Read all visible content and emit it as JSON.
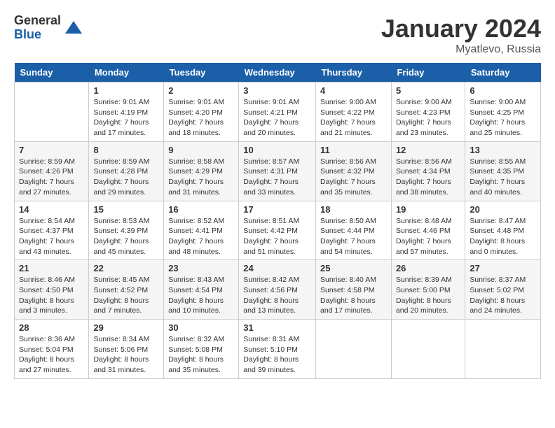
{
  "header": {
    "logo_general": "General",
    "logo_blue": "Blue",
    "month_title": "January 2024",
    "location": "Myatlevo, Russia"
  },
  "days_of_week": [
    "Sunday",
    "Monday",
    "Tuesday",
    "Wednesday",
    "Thursday",
    "Friday",
    "Saturday"
  ],
  "weeks": [
    [
      {
        "day": "",
        "info": ""
      },
      {
        "day": "1",
        "info": "Sunrise: 9:01 AM\nSunset: 4:19 PM\nDaylight: 7 hours\nand 17 minutes."
      },
      {
        "day": "2",
        "info": "Sunrise: 9:01 AM\nSunset: 4:20 PM\nDaylight: 7 hours\nand 18 minutes."
      },
      {
        "day": "3",
        "info": "Sunrise: 9:01 AM\nSunset: 4:21 PM\nDaylight: 7 hours\nand 20 minutes."
      },
      {
        "day": "4",
        "info": "Sunrise: 9:00 AM\nSunset: 4:22 PM\nDaylight: 7 hours\nand 21 minutes."
      },
      {
        "day": "5",
        "info": "Sunrise: 9:00 AM\nSunset: 4:23 PM\nDaylight: 7 hours\nand 23 minutes."
      },
      {
        "day": "6",
        "info": "Sunrise: 9:00 AM\nSunset: 4:25 PM\nDaylight: 7 hours\nand 25 minutes."
      }
    ],
    [
      {
        "day": "7",
        "info": "Sunrise: 8:59 AM\nSunset: 4:26 PM\nDaylight: 7 hours\nand 27 minutes."
      },
      {
        "day": "8",
        "info": "Sunrise: 8:59 AM\nSunset: 4:28 PM\nDaylight: 7 hours\nand 29 minutes."
      },
      {
        "day": "9",
        "info": "Sunrise: 8:58 AM\nSunset: 4:29 PM\nDaylight: 7 hours\nand 31 minutes."
      },
      {
        "day": "10",
        "info": "Sunrise: 8:57 AM\nSunset: 4:31 PM\nDaylight: 7 hours\nand 33 minutes."
      },
      {
        "day": "11",
        "info": "Sunrise: 8:56 AM\nSunset: 4:32 PM\nDaylight: 7 hours\nand 35 minutes."
      },
      {
        "day": "12",
        "info": "Sunrise: 8:56 AM\nSunset: 4:34 PM\nDaylight: 7 hours\nand 38 minutes."
      },
      {
        "day": "13",
        "info": "Sunrise: 8:55 AM\nSunset: 4:35 PM\nDaylight: 7 hours\nand 40 minutes."
      }
    ],
    [
      {
        "day": "14",
        "info": "Sunrise: 8:54 AM\nSunset: 4:37 PM\nDaylight: 7 hours\nand 43 minutes."
      },
      {
        "day": "15",
        "info": "Sunrise: 8:53 AM\nSunset: 4:39 PM\nDaylight: 7 hours\nand 45 minutes."
      },
      {
        "day": "16",
        "info": "Sunrise: 8:52 AM\nSunset: 4:41 PM\nDaylight: 7 hours\nand 48 minutes."
      },
      {
        "day": "17",
        "info": "Sunrise: 8:51 AM\nSunset: 4:42 PM\nDaylight: 7 hours\nand 51 minutes."
      },
      {
        "day": "18",
        "info": "Sunrise: 8:50 AM\nSunset: 4:44 PM\nDaylight: 7 hours\nand 54 minutes."
      },
      {
        "day": "19",
        "info": "Sunrise: 8:48 AM\nSunset: 4:46 PM\nDaylight: 7 hours\nand 57 minutes."
      },
      {
        "day": "20",
        "info": "Sunrise: 8:47 AM\nSunset: 4:48 PM\nDaylight: 8 hours\nand 0 minutes."
      }
    ],
    [
      {
        "day": "21",
        "info": "Sunrise: 8:46 AM\nSunset: 4:50 PM\nDaylight: 8 hours\nand 3 minutes."
      },
      {
        "day": "22",
        "info": "Sunrise: 8:45 AM\nSunset: 4:52 PM\nDaylight: 8 hours\nand 7 minutes."
      },
      {
        "day": "23",
        "info": "Sunrise: 8:43 AM\nSunset: 4:54 PM\nDaylight: 8 hours\nand 10 minutes."
      },
      {
        "day": "24",
        "info": "Sunrise: 8:42 AM\nSunset: 4:56 PM\nDaylight: 8 hours\nand 13 minutes."
      },
      {
        "day": "25",
        "info": "Sunrise: 8:40 AM\nSunset: 4:58 PM\nDaylight: 8 hours\nand 17 minutes."
      },
      {
        "day": "26",
        "info": "Sunrise: 8:39 AM\nSunset: 5:00 PM\nDaylight: 8 hours\nand 20 minutes."
      },
      {
        "day": "27",
        "info": "Sunrise: 8:37 AM\nSunset: 5:02 PM\nDaylight: 8 hours\nand 24 minutes."
      }
    ],
    [
      {
        "day": "28",
        "info": "Sunrise: 8:36 AM\nSunset: 5:04 PM\nDaylight: 8 hours\nand 27 minutes."
      },
      {
        "day": "29",
        "info": "Sunrise: 8:34 AM\nSunset: 5:06 PM\nDaylight: 8 hours\nand 31 minutes."
      },
      {
        "day": "30",
        "info": "Sunrise: 8:32 AM\nSunset: 5:08 PM\nDaylight: 8 hours\nand 35 minutes."
      },
      {
        "day": "31",
        "info": "Sunrise: 8:31 AM\nSunset: 5:10 PM\nDaylight: 8 hours\nand 39 minutes."
      },
      {
        "day": "",
        "info": ""
      },
      {
        "day": "",
        "info": ""
      },
      {
        "day": "",
        "info": ""
      }
    ]
  ]
}
